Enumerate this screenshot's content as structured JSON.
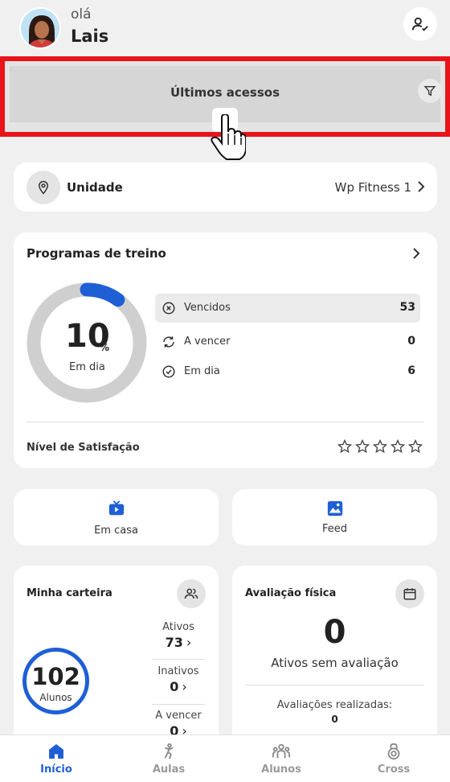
{
  "header": {
    "greeting": "olá",
    "name": "Lais",
    "avatar_icon": "person-avatar-icon",
    "user_button_icon": "user-check-icon"
  },
  "recent_access": {
    "title": "Últimos acessos",
    "filter_icon": "filter-icon",
    "expand_icon": "chevron-down-icon"
  },
  "unit": {
    "label": "Unidade",
    "value": "Wp Fitness 1",
    "icon": "location-pin-icon"
  },
  "programs": {
    "title": "Programas de treino",
    "percent_value": "10",
    "percent_sign": "%",
    "percent_label": "Em dia",
    "progress_fraction": 0.1,
    "stats": [
      {
        "label": "Vencidos",
        "value": "53",
        "icon": "x-circle-icon"
      },
      {
        "label": "A vencer",
        "value": "0",
        "icon": "refresh-icon"
      },
      {
        "label": "Em dia",
        "value": "6",
        "icon": "check-circle-icon"
      }
    ],
    "satisfaction_label": "Nível de Satisfação",
    "satisfaction_stars": 0,
    "satisfaction_max": 5
  },
  "shortcuts": {
    "home": {
      "label": "Em casa",
      "icon": "tv-play-icon"
    },
    "feed": {
      "label": "Feed",
      "icon": "image-icon"
    }
  },
  "wallet": {
    "title": "Minha carteira",
    "icon": "users-icon",
    "total": "102",
    "total_label": "Alunos",
    "stats": [
      {
        "label": "Ativos",
        "value": "73"
      },
      {
        "label": "Inativos",
        "value": "0"
      },
      {
        "label": "A vencer",
        "value": "0"
      }
    ]
  },
  "evaluation": {
    "title": "Avaliação física",
    "icon": "calendar-icon",
    "value": "0",
    "value_label": "Ativos sem avaliação",
    "done_label": "Avaliações realizadas:",
    "done_value": "0"
  },
  "bottom_nav": [
    {
      "label": "Início",
      "icon": "home-icon",
      "active": true
    },
    {
      "label": "Aulas",
      "icon": "exercise-icon",
      "active": false
    },
    {
      "label": "Alunos",
      "icon": "group-icon",
      "active": false
    },
    {
      "label": "Cross",
      "icon": "kettlebell-icon",
      "active": false
    }
  ],
  "colors": {
    "accent": "#1f5fd6",
    "highlight_border": "#e8141a",
    "background": "#f0f0f0"
  }
}
